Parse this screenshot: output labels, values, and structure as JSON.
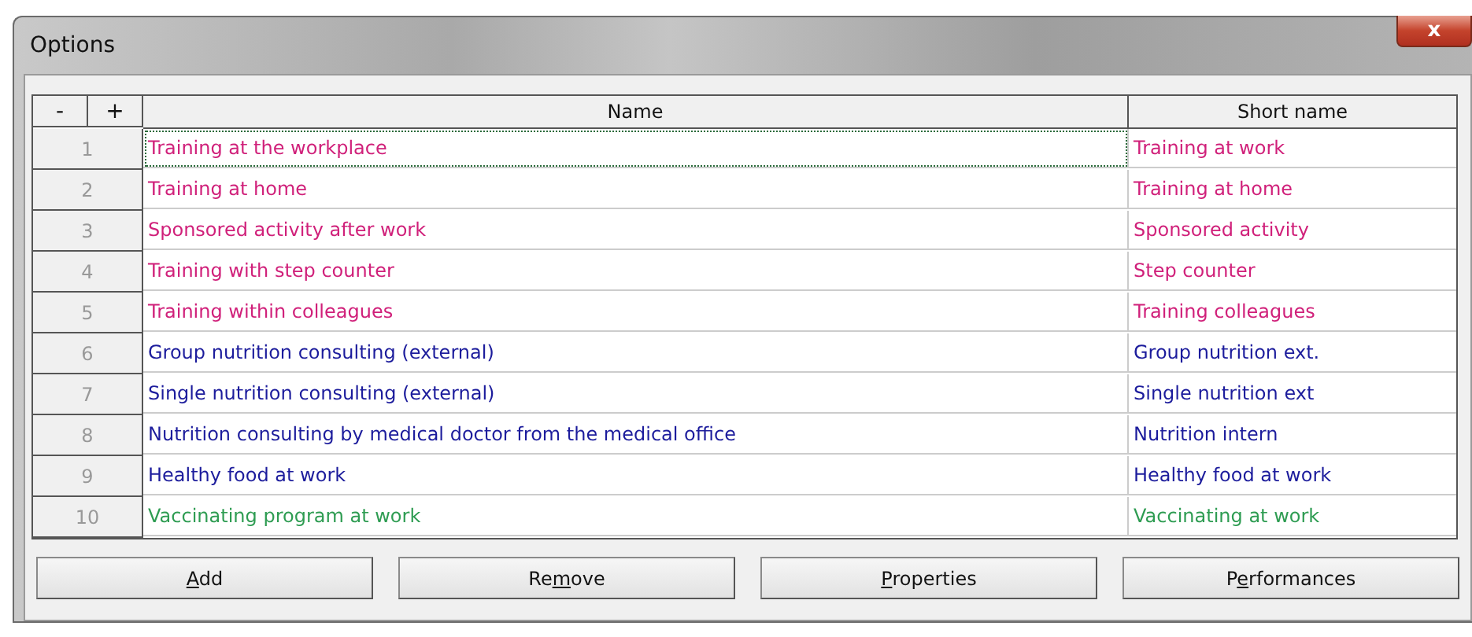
{
  "window": {
    "title": "Options",
    "close_label": "x"
  },
  "table": {
    "corner_buttons": [
      "-",
      "+"
    ],
    "columns": [
      "Name",
      "Short name"
    ],
    "rows": [
      {
        "number": "1",
        "name": "Training at the workplace",
        "short_name": "Training at work",
        "color": "#d0207a",
        "selected": true
      },
      {
        "number": "2",
        "name": "Training at home",
        "short_name": "Training at home",
        "color": "#d0207a",
        "selected": false
      },
      {
        "number": "3",
        "name": "Sponsored activity after work",
        "short_name": "Sponsored activity",
        "color": "#d0207a",
        "selected": false
      },
      {
        "number": "4",
        "name": "Training with step counter",
        "short_name": "Step counter",
        "color": "#d0207a",
        "selected": false
      },
      {
        "number": "5",
        "name": "Training within colleagues",
        "short_name": "Training colleagues",
        "color": "#d0207a",
        "selected": false
      },
      {
        "number": "6",
        "name": "Group nutrition consulting (external)",
        "short_name": "Group nutrition ext.",
        "color": "#1c1c9c",
        "selected": false
      },
      {
        "number": "7",
        "name": "Single nutrition consulting (external)",
        "short_name": "Single nutrition ext",
        "color": "#1c1c9c",
        "selected": false
      },
      {
        "number": "8",
        "name": "Nutrition consulting by medical doctor from the medical office",
        "short_name": "Nutrition intern",
        "color": "#1c1c9c",
        "selected": false
      },
      {
        "number": "9",
        "name": "Healthy food at work",
        "short_name": "Healthy food at work",
        "color": "#1c1c9c",
        "selected": false
      },
      {
        "number": "10",
        "name": "Vaccinating program at work",
        "short_name": "Vaccinating at work",
        "color": "#2e9c52",
        "selected": false
      }
    ]
  },
  "buttons": [
    {
      "access_key": "A",
      "after": "dd"
    },
    {
      "before": "Re",
      "access_key": "m",
      "after": "ove"
    },
    {
      "access_key": "P",
      "after": "roperties"
    },
    {
      "before": "P",
      "access_key": "e",
      "after": "rformances"
    }
  ]
}
